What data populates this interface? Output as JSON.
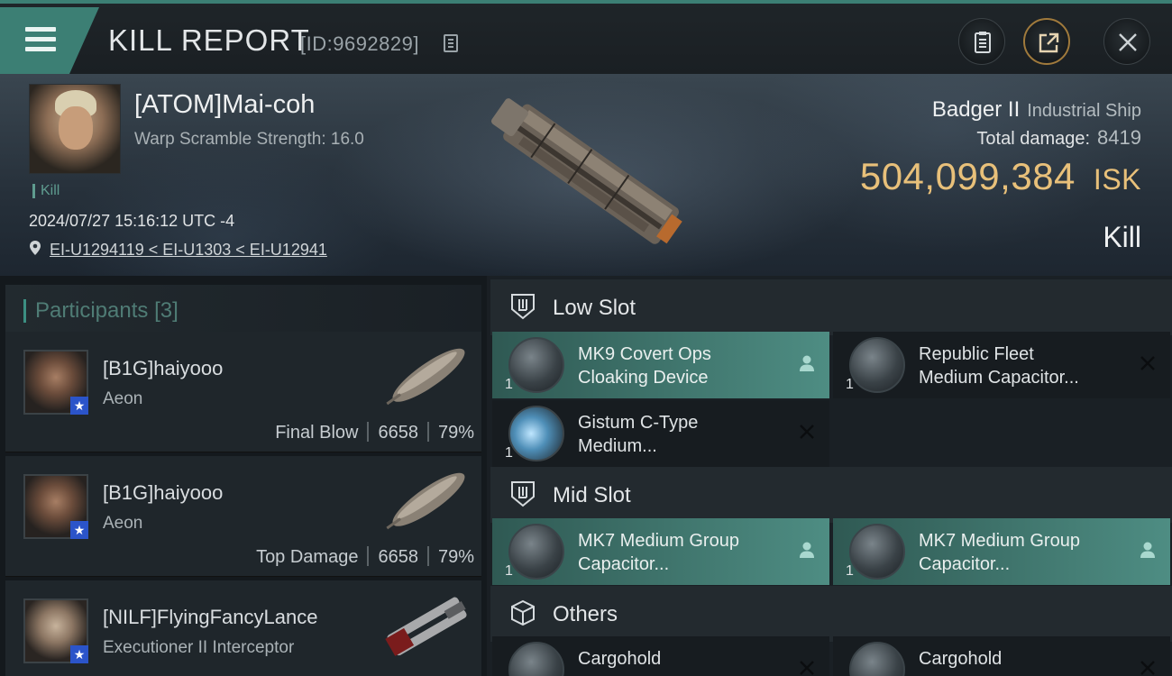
{
  "header": {
    "title": "KILL REPORT",
    "report_id": "[ID:9692829]"
  },
  "victim": {
    "name": "[ATOM]Mai-coh",
    "warp_strength": "Warp Scramble Strength: 16.0",
    "kill_tag": "Kill",
    "datetime": "2024/07/27 15:16:12 UTC -4",
    "location": "EI-U1294119 < EI-U1303 < EI-U12941",
    "ship": "Badger II",
    "ship_class": "Industrial Ship",
    "total_damage_label": "Total damage:",
    "total_damage": "8419",
    "isk_value": "504,099,384",
    "isk_unit": "ISK",
    "result": "Kill"
  },
  "participants": {
    "label": "Participants",
    "count": "[3]",
    "rows": [
      {
        "name": "[B1G]haiyooo",
        "ship": "Aeon",
        "role": "Final Blow",
        "damage": "6658",
        "pct": "79%"
      },
      {
        "name": "[B1G]haiyooo",
        "ship": "Aeon",
        "role": "Top Damage",
        "damage": "6658",
        "pct": "79%"
      },
      {
        "name": "[NILF]FlyingFancyLance",
        "ship": "Executioner II Interceptor"
      }
    ]
  },
  "slots": {
    "low": {
      "label": "Low Slot",
      "items": [
        {
          "qty": "1",
          "name": "MK9 Covert Ops Cloaking Device",
          "line1": "MK9 Covert Ops",
          "line2": "Cloaking Device",
          "status": "dropped",
          "icon": "cloak-module-icon"
        },
        {
          "qty": "1",
          "name": "Republic Fleet Medium Capacitor...",
          "line1": "Republic Fleet",
          "line2": "Medium Capacitor...",
          "status": "destroyed",
          "icon": "capacitor-booster-icon"
        },
        {
          "qty": "1",
          "name": "Gistum C-Type Medium...",
          "line1": "Gistum C-Type",
          "line2": "Medium...",
          "status": "destroyed",
          "icon": "shield-extender-icon"
        }
      ]
    },
    "mid": {
      "label": "Mid Slot",
      "items": [
        {
          "qty": "1",
          "line1": "MK7 Medium Group",
          "line2": "Capacitor...",
          "status": "dropped",
          "icon": "capacitor-repair-icon"
        },
        {
          "qty": "1",
          "line1": "MK7 Medium Group",
          "line2": "Capacitor...",
          "status": "dropped",
          "icon": "capacitor-repair-icon"
        }
      ]
    },
    "others": {
      "label": "Others",
      "items": [
        {
          "line1": "Cargohold",
          "status": "destroyed",
          "icon": "cargohold-icon"
        },
        {
          "line1": "Cargohold",
          "status": "destroyed",
          "icon": "cargohold-icon"
        }
      ]
    }
  },
  "colors": {
    "accent": "#3c7f74",
    "isk": "#e8c07a",
    "highlight_item": "#4e8d83",
    "corp_badge": "#2b54c9"
  }
}
